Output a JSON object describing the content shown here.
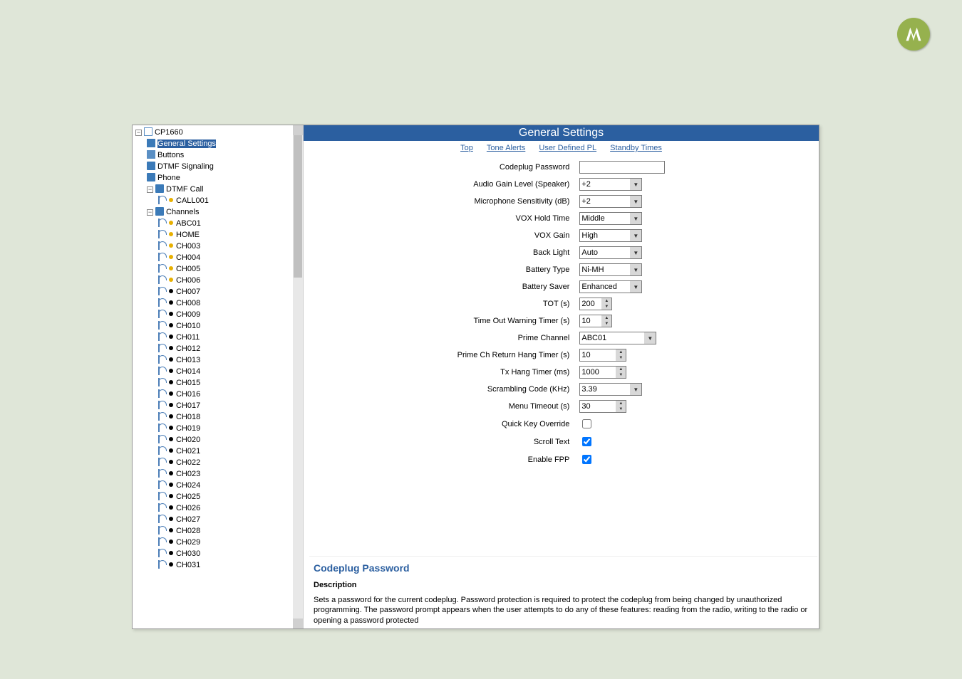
{
  "logo": {
    "name": "motorola-logo"
  },
  "tree": {
    "root": "CP1660",
    "items": [
      {
        "id": "general",
        "label": "General Settings",
        "selected": true
      },
      {
        "id": "buttons",
        "label": "Buttons"
      },
      {
        "id": "dtmf_sig",
        "label": "DTMF Signaling"
      },
      {
        "id": "phone",
        "label": "Phone"
      }
    ],
    "dtmf_call": {
      "label": "DTMF Call",
      "children": [
        "CALL001"
      ]
    },
    "channels_label": "Channels",
    "channels": [
      "ABC01",
      "HOME",
      "CH003",
      "CH004",
      "CH005",
      "CH006",
      "CH007",
      "CH008",
      "CH009",
      "CH010",
      "CH011",
      "CH012",
      "CH013",
      "CH014",
      "CH015",
      "CH016",
      "CH017",
      "CH018",
      "CH019",
      "CH020",
      "CH021",
      "CH022",
      "CH023",
      "CH024",
      "CH025",
      "CH026",
      "CH027",
      "CH028",
      "CH029",
      "CH030",
      "CH031"
    ],
    "black_from_index": 6
  },
  "page": {
    "title": "General Settings",
    "nav": [
      "Top",
      "Tone Alerts",
      "User Defined PL",
      "Standby Times"
    ]
  },
  "form": {
    "codeplug_password": {
      "label": "Codeplug Password",
      "value": ""
    },
    "audio_gain": {
      "label": "Audio Gain Level (Speaker)",
      "value": "+2"
    },
    "mic_sens": {
      "label": "Microphone Sensitivity (dB)",
      "value": "+2"
    },
    "vox_hold": {
      "label": "VOX Hold Time",
      "value": "Middle"
    },
    "vox_gain": {
      "label": "VOX Gain",
      "value": "High"
    },
    "back_light": {
      "label": "Back Light",
      "value": "Auto"
    },
    "battery_type": {
      "label": "Battery Type",
      "value": "Ni-MH"
    },
    "battery_saver": {
      "label": "Battery Saver",
      "value": "Enhanced"
    },
    "tot": {
      "label": "TOT (s)",
      "value": "200"
    },
    "tow_timer": {
      "label": "Time Out Warning Timer (s)",
      "value": "10"
    },
    "prime_ch": {
      "label": "Prime Channel",
      "value": "ABC01"
    },
    "prime_ch_return": {
      "label": "Prime Ch Return Hang Timer (s)",
      "value": "10"
    },
    "tx_hang": {
      "label": "Tx Hang Timer (ms)",
      "value": "1000"
    },
    "scramble": {
      "label": "Scrambling Code (KHz)",
      "value": "3.39"
    },
    "menu_timeout": {
      "label": "Menu Timeout (s)",
      "value": "30"
    },
    "quick_key": {
      "label": "Quick Key Override",
      "checked": false
    },
    "scroll_text": {
      "label": "Scroll Text",
      "checked": true
    },
    "enable_fpp": {
      "label": "Enable FPP",
      "checked": true
    }
  },
  "help": {
    "title": "Codeplug Password",
    "desc_heading": "Description",
    "body": "Sets a password for the current codeplug. Password protection is required to protect the codeplug from being changed by unauthorized programming. The password prompt appears when the user attempts to do any of these features: reading from the radio, writing to the radio or opening a password protected"
  }
}
